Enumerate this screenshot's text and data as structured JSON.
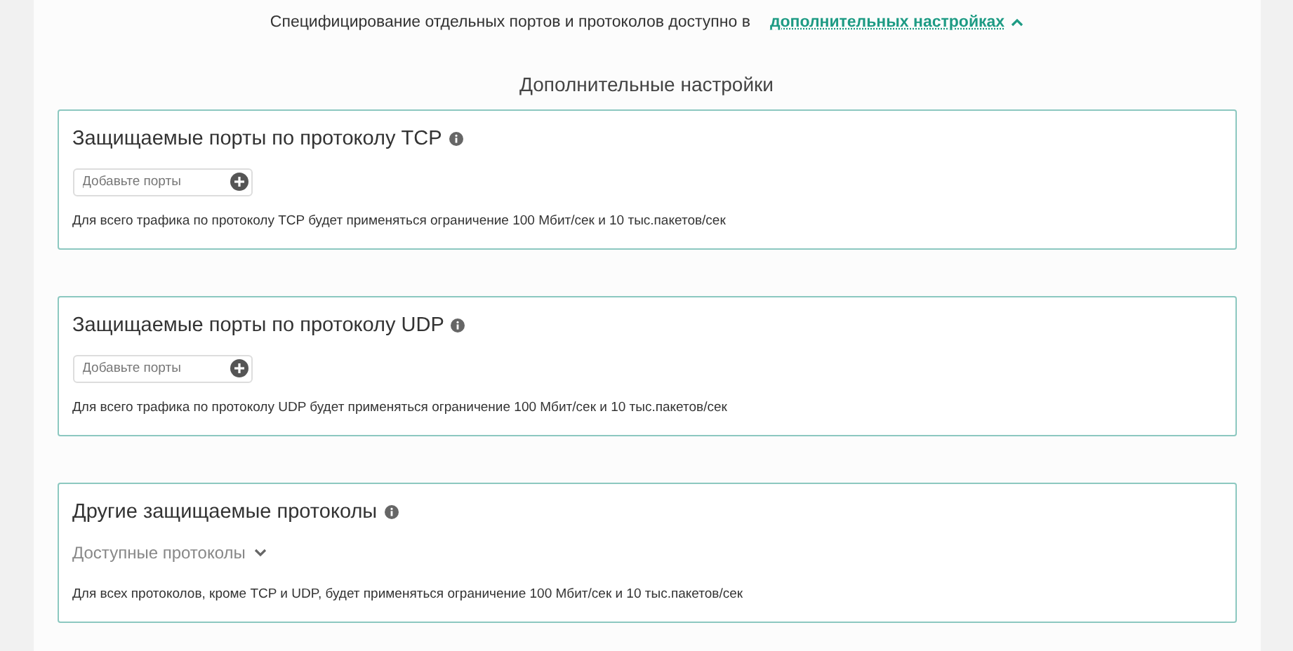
{
  "notice": {
    "text": "Специфицирование отдельных портов и протоколов доступно в",
    "link": "дополнительных настройках",
    "expanded": true
  },
  "section_title": "Дополнительные настройки",
  "cards": [
    {
      "kind": "ports",
      "title": "Защищаемые порты по протоколу TCP",
      "placeholder": "Добавьте порты",
      "note": "Для всего трафика по протоколу TCP будет применяться ограничение 100 Мбит/сек и 10 тыс.пакетов/сек"
    },
    {
      "kind": "ports",
      "title": "Защищаемые порты по протоколу UDP",
      "placeholder": "Добавьте порты",
      "note": "Для всего трафика по протоколу UDP будет применяться ограничение 100 Мбит/сек и 10 тыс.пакетов/сек"
    },
    {
      "kind": "protocols",
      "title": "Другие защищаемые протоколы",
      "dropdown": "Доступные протоколы",
      "expanded": false,
      "note": "Для всех протоколов, кроме TCP и UDP, будет применяться ограничение 100 Мбит/сек и 10 тыс.пакетов/сек"
    }
  ]
}
